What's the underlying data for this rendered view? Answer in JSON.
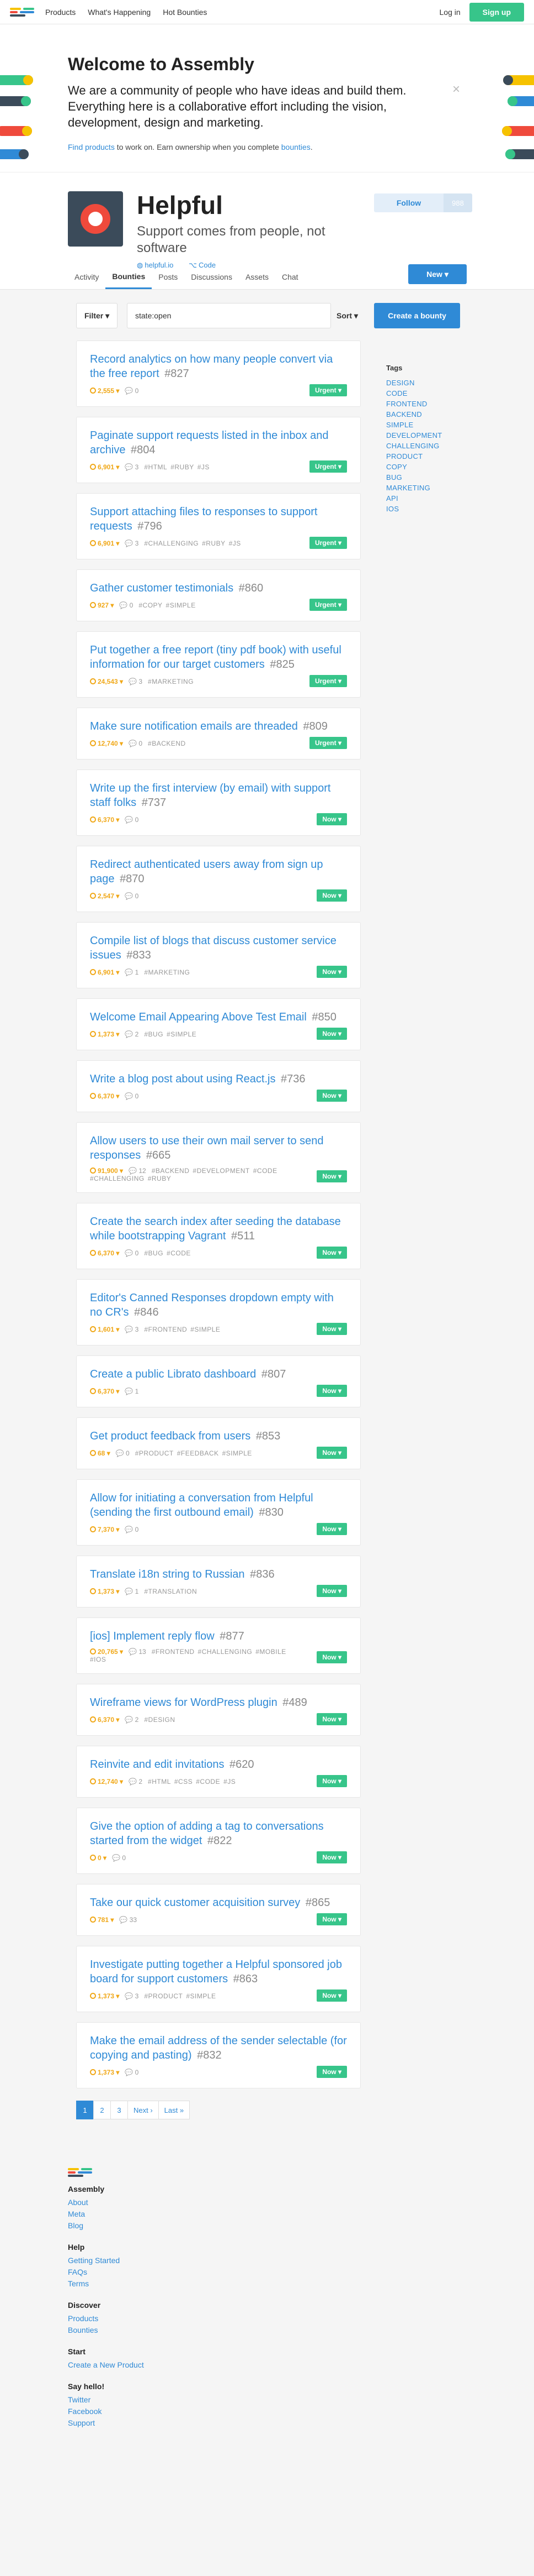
{
  "nav": {
    "links": [
      "Products",
      "What's Happening",
      "Hot Bounties"
    ],
    "login": "Log in",
    "signup": "Sign up"
  },
  "welcome": {
    "title": "Welcome to Assembly",
    "lead": "We are a community of people who have ideas and build them. Everything here is a collaborative effort including the vision, development, design and marketing.",
    "small_link1": "Find products",
    "small_mid": " to work on. Earn ownership when you complete ",
    "small_link2": "bounties",
    "small_end": ".",
    "close": "×"
  },
  "product": {
    "name": "Helpful",
    "pitch": "Support comes from people, not software",
    "site": "helpful.io",
    "code": "Code",
    "follow": "Follow",
    "follow_count": "988",
    "tabs": [
      "Activity",
      "Bounties",
      "Posts",
      "Discussions",
      "Assets",
      "Chat"
    ],
    "active_tab": "Bounties",
    "new_button": "New ▾"
  },
  "filters": {
    "filter_label": "Filter ▾",
    "query": "state:open",
    "sort_label": "Sort ▾",
    "create": "Create a bounty"
  },
  "bounties": [
    {
      "title": "Record analytics on how many people convert via the free report",
      "num": "#827",
      "coins": "2,555",
      "comments": "0",
      "tags": [],
      "status": "Urgent ▾"
    },
    {
      "title": "Paginate support requests listed in the inbox and archive",
      "num": "#804",
      "coins": "6,901",
      "comments": "3",
      "tags": [
        "#HTML",
        "#RUBY",
        "#JS"
      ],
      "status": "Urgent ▾"
    },
    {
      "title": "Support attaching files to responses to support requests",
      "num": "#796",
      "coins": "6,901",
      "comments": "3",
      "tags": [
        "#CHALLENGING",
        "#RUBY",
        "#JS"
      ],
      "status": "Urgent ▾"
    },
    {
      "title": "Gather customer testimonials",
      "num": "#860",
      "coins": "927",
      "comments": "0",
      "tags": [
        "#COPY",
        "#SIMPLE"
      ],
      "status": "Urgent ▾"
    },
    {
      "title": "Put together a free report (tiny pdf book) with useful information for our target customers",
      "num": "#825",
      "coins": "24,543",
      "comments": "3",
      "tags": [
        "#MARKETING"
      ],
      "status": "Urgent ▾"
    },
    {
      "title": "Make sure notification emails are threaded",
      "num": "#809",
      "coins": "12,740",
      "comments": "0",
      "tags": [
        "#BACKEND"
      ],
      "status": "Urgent ▾"
    },
    {
      "title": "Write up the first interview (by email) with support staff folks",
      "num": "#737",
      "coins": "6,370",
      "comments": "0",
      "tags": [],
      "status": "Now ▾"
    },
    {
      "title": "Redirect authenticated users away from sign up page",
      "num": "#870",
      "coins": "2,547",
      "comments": "0",
      "tags": [],
      "status": "Now ▾"
    },
    {
      "title": "Compile list of blogs that discuss customer service issues",
      "num": "#833",
      "coins": "6,901",
      "comments": "1",
      "tags": [
        "#MARKETING"
      ],
      "status": "Now ▾"
    },
    {
      "title": "Welcome Email Appearing Above Test Email",
      "num": "#850",
      "coins": "1,373",
      "comments": "2",
      "tags": [
        "#BUG",
        "#SIMPLE"
      ],
      "status": "Now ▾"
    },
    {
      "title": "Write a blog post about using React.js",
      "num": "#736",
      "coins": "6,370",
      "comments": "0",
      "tags": [],
      "status": "Now ▾"
    },
    {
      "title": "Allow users to use their own mail server to send responses",
      "num": "#665",
      "coins": "91,900",
      "comments": "12",
      "tags": [
        "#BACKEND",
        "#DEVELOPMENT",
        "#CODE",
        "#CHALLENGING",
        "#RUBY"
      ],
      "status": "Now ▾"
    },
    {
      "title": "Create the search index after seeding the database while bootstrapping Vagrant",
      "num": "#511",
      "coins": "6,370",
      "comments": "0",
      "tags": [
        "#BUG",
        "#CODE"
      ],
      "status": "Now ▾"
    },
    {
      "title": "Editor's Canned Responses dropdown empty with no CR's",
      "num": "#846",
      "coins": "1,601",
      "comments": "3",
      "tags": [
        "#FRONTEND",
        "#SIMPLE"
      ],
      "status": "Now ▾"
    },
    {
      "title": "Create a public Librato dashboard",
      "num": "#807",
      "coins": "6,370",
      "comments": "1",
      "tags": [],
      "status": "Now ▾"
    },
    {
      "title": "Get product feedback from users",
      "num": "#853",
      "coins": "68",
      "comments": "0",
      "tags": [
        "#PRODUCT",
        "#FEEDBACK",
        "#SIMPLE"
      ],
      "status": "Now ▾"
    },
    {
      "title": "Allow for initiating a conversation from Helpful (sending the first outbound email)",
      "num": "#830",
      "coins": "7,370",
      "comments": "0",
      "tags": [],
      "status": "Now ▾"
    },
    {
      "title": "Translate i18n string to Russian",
      "num": "#836",
      "coins": "1,373",
      "comments": "1",
      "tags": [
        "#TRANSLATION"
      ],
      "status": "Now ▾"
    },
    {
      "title": "[ios] Implement reply flow",
      "num": "#877",
      "coins": "20,765",
      "comments": "13",
      "tags": [
        "#FRONTEND",
        "#CHALLENGING",
        "#MOBILE",
        "#IOS"
      ],
      "status": "Now ▾"
    },
    {
      "title": "Wireframe views for WordPress plugin",
      "num": "#489",
      "coins": "6,370",
      "comments": "2",
      "tags": [
        "#DESIGN"
      ],
      "status": "Now ▾"
    },
    {
      "title": "Reinvite and edit invitations",
      "num": "#620",
      "coins": "12,740",
      "comments": "2",
      "tags": [
        "#HTML",
        "#CSS",
        "#CODE",
        "#JS"
      ],
      "status": "Now ▾"
    },
    {
      "title": "Give the option of adding a tag to conversations started from the widget",
      "num": "#822",
      "coins": "0",
      "comments": "0",
      "tags": [],
      "status": "Now ▾"
    },
    {
      "title": "Take our quick customer acquisition survey",
      "num": "#865",
      "coins": "781",
      "comments": "33",
      "tags": [],
      "status": "Now ▾"
    },
    {
      "title": "Investigate putting together a Helpful sponsored job board for support customers",
      "num": "#863",
      "coins": "1,373",
      "comments": "3",
      "tags": [
        "#PRODUCT",
        "#SIMPLE"
      ],
      "status": "Now ▾"
    },
    {
      "title": "Make the email address of the sender selectable (for copying and pasting)",
      "num": "#832",
      "coins": "1,373",
      "comments": "0",
      "tags": [],
      "status": "Now ▾"
    }
  ],
  "sidebar": {
    "heading": "Tags",
    "tags": [
      "DESIGN",
      "CODE",
      "FRONTEND",
      "BACKEND",
      "SIMPLE",
      "DEVELOPMENT",
      "CHALLENGING",
      "PRODUCT",
      "COPY",
      "BUG",
      "MARKETING",
      "API",
      "IOS"
    ]
  },
  "pagination": [
    "1",
    "2",
    "3",
    "Next ›",
    "Last »"
  ],
  "footer": {
    "sections": [
      {
        "heading": "Assembly",
        "links": [
          "About",
          "Meta",
          "Blog"
        ]
      },
      {
        "heading": "Help",
        "links": [
          "Getting Started",
          "FAQs",
          "Terms"
        ]
      },
      {
        "heading": "Discover",
        "links": [
          "Products",
          "Bounties"
        ]
      },
      {
        "heading": "Start",
        "links": [
          "Create a New Product"
        ]
      },
      {
        "heading": "Say hello!",
        "links": [
          "Twitter",
          "Facebook",
          "Support"
        ]
      }
    ]
  },
  "colors": {
    "accent": "#2f8ad6",
    "green": "#37c58a",
    "coin": "#f0a818",
    "brand_red": "#ef4a3c"
  }
}
